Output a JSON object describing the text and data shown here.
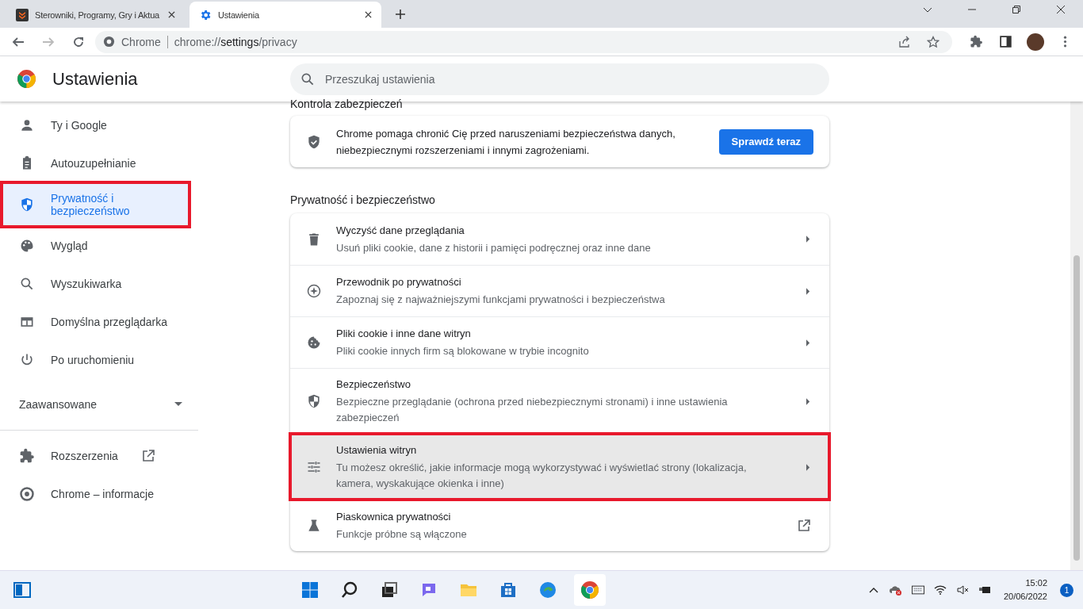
{
  "tabs": [
    {
      "title": "Sterowniki, Programy, Gry i Aktua",
      "selected": false
    },
    {
      "title": "Ustawienia",
      "selected": true
    }
  ],
  "address_bar": {
    "site_label": "Chrome",
    "url_prefix": "chrome://",
    "url_host": "settings",
    "url_path": "/privacy"
  },
  "settings_header": {
    "title": "Ustawienia",
    "search_placeholder": "Przeszukaj ustawienia"
  },
  "sidebar": {
    "items": [
      {
        "label": "Ty i Google",
        "selected": false,
        "highlighted": false
      },
      {
        "label": "Autouzupełnianie",
        "selected": false,
        "highlighted": false
      },
      {
        "label": "Prywatność i bezpieczeństwo",
        "selected": true,
        "highlighted": true
      },
      {
        "label": "Wygląd",
        "selected": false,
        "highlighted": false
      },
      {
        "label": "Wyszukiwarka",
        "selected": false,
        "highlighted": false
      },
      {
        "label": "Domyślna przeglądarka",
        "selected": false,
        "highlighted": false
      },
      {
        "label": "Po uruchomieniu",
        "selected": false,
        "highlighted": false
      }
    ],
    "advanced": {
      "label": "Zaawansowane",
      "expanded": false
    },
    "bottom_items": [
      {
        "label": "Rozszerzenia",
        "kind": "external"
      },
      {
        "label": "Chrome – informacje",
        "kind": "plain"
      }
    ]
  },
  "safety_check": {
    "heading": "Kontrola zabezpieczeń",
    "text": "Chrome pomaga chronić Cię przed naruszeniami bezpieczeństwa danych, niebezpiecznymi rozszerzeniami i innymi zagrożeniami.",
    "button": "Sprawdź teraz"
  },
  "privacy_section": {
    "heading": "Prywatność i bezpieczeństwo",
    "rows": [
      {
        "title": "Wyczyść dane przeglądania",
        "subtitle": "Usuń pliki cookie, dane z historii i pamięci podręcznej oraz inne dane",
        "kind": "arrow",
        "highlighted": false
      },
      {
        "title": "Przewodnik po prywatności",
        "subtitle": "Zapoznaj się z najważniejszymi funkcjami prywatności i bezpieczeństwa",
        "kind": "arrow",
        "highlighted": false
      },
      {
        "title": "Pliki cookie i inne dane witryn",
        "subtitle": "Pliki cookie innych firm są blokowane w trybie incognito",
        "kind": "arrow",
        "highlighted": false
      },
      {
        "title": "Bezpieczeństwo",
        "subtitle": "Bezpieczne przeglądanie (ochrona przed niebezpiecznymi stronami) i inne ustawienia zabezpieczeń",
        "kind": "arrow",
        "highlighted": false
      },
      {
        "title": "Ustawienia witryn",
        "subtitle": "Tu możesz określić, jakie informacje mogą wykorzystywać i wyświetlać strony (lokalizacja, kamera, wyskakujące okienka i inne)",
        "kind": "arrow",
        "highlighted": true
      },
      {
        "title": "Piaskownica prywatności",
        "subtitle": "Funkcje próbne są włączone",
        "kind": "external",
        "highlighted": false
      }
    ]
  },
  "taskbar": {
    "time": "15:02",
    "date": "20/06/2022",
    "notifications": "1"
  }
}
